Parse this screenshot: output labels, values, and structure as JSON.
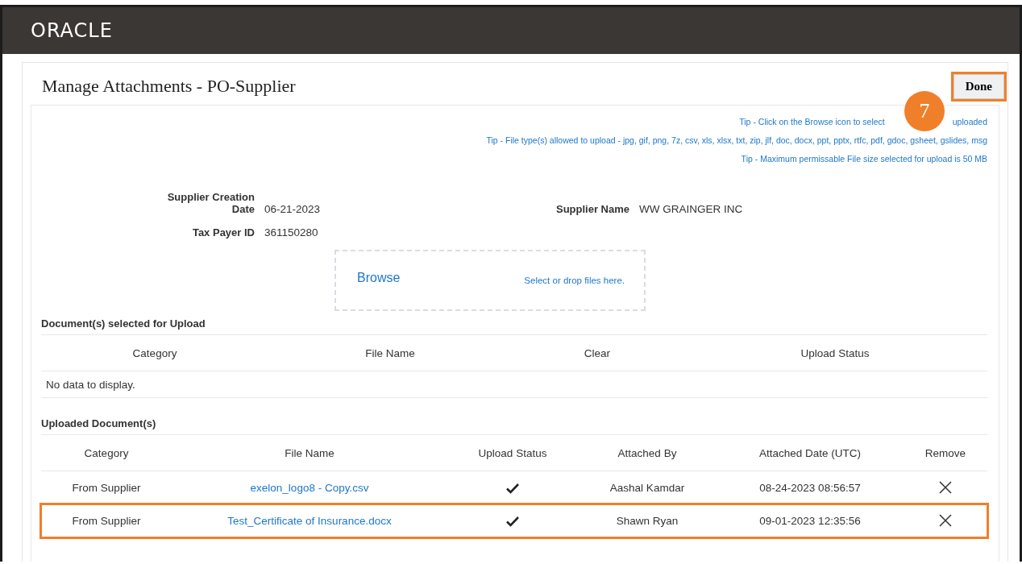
{
  "header": {
    "logo": "ORACLE"
  },
  "page": {
    "title": "Manage Attachments - PO-Supplier",
    "done_button": {
      "label": "Done",
      "highlighted": true
    },
    "step_badge": "7"
  },
  "tips": [
    {
      "parts": [
        "Tip - Click on the Browse icon to select",
        "uploaded"
      ]
    },
    {
      "parts": [
        "Tip - File type(s) allowed to upload - jpg, gif, png, 7z, csv, xls, xlsx, txt, zip, jlf, doc, docx, ppt, pptx, rtfc, pdf, gdoc, gsheet, gslides, msg"
      ]
    },
    {
      "parts": [
        "Tip - Maximum permissable File size selected for upload is 50 MB"
      ]
    }
  ],
  "fields": {
    "supplier_creation_date": {
      "label_lines": [
        "Supplier Creation",
        "Date"
      ],
      "value": "06-21-2023"
    },
    "supplier_name": {
      "label": "Supplier Name",
      "value": "WW GRAINGER INC"
    },
    "tax_payer_id": {
      "label": "Tax Payer ID",
      "value": "361150280"
    }
  },
  "dropzone": {
    "browse": "Browse",
    "hint": "Select or drop files here."
  },
  "selected_for_upload": {
    "title": "Document(s) selected for Upload",
    "columns": [
      "Category",
      "File Name",
      "Clear",
      "Upload Status"
    ],
    "empty_text": "No data to display."
  },
  "uploaded": {
    "title": "Uploaded Document(s)",
    "columns": [
      "Category",
      "File Name",
      "Upload Status",
      "Attached By",
      "Attached Date (UTC)",
      "Remove"
    ],
    "rows": [
      {
        "category": "From Supplier",
        "file_name": "exelon_logo8 - Copy.csv",
        "uploaded": true,
        "attached_by": "Aashal Kamdar",
        "attached_date": "08-24-2023 08:56:57",
        "highlighted": false
      },
      {
        "category": "From Supplier",
        "file_name": "Test_Certificate of Insurance.docx",
        "uploaded": true,
        "attached_by": "Shawn Ryan",
        "attached_date": "09-01-2023 12:35:56",
        "highlighted": true
      }
    ]
  }
}
